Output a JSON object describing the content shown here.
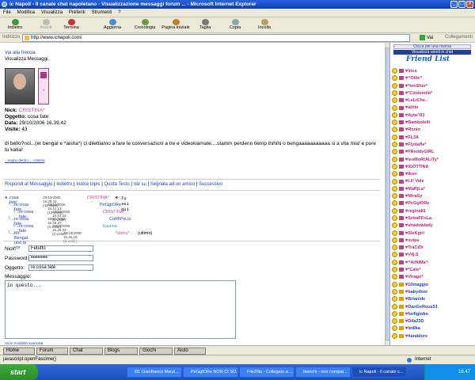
{
  "window": {
    "title": "ic Napoli - Il canale chat napoletano - Visualizzazione messaggi forum ... - Microsoft Internet Explorer"
  },
  "menu": [
    "File",
    "Modifica",
    "Visualizza",
    "Preferiti",
    "Strumenti",
    "?"
  ],
  "toolbar": {
    "back": "Indietro",
    "forward": "Avanti",
    "stop": "Termina",
    "refresh": "Aggiorna",
    "history": "Cronologia",
    "home": "Pagina iniziale",
    "cut": "Taglia",
    "copy": "Copia",
    "paste": "Incolla"
  },
  "address": {
    "label": "Indirizzo",
    "url": "http://www.icnapoli.com/",
    "go": "Vai",
    "links": "Collegamenti"
  },
  "post": {
    "goto_arrow": "Vai alla freccia",
    "heading": "Visualizza Messaggi.",
    "nick_label": "Nick:",
    "nick": "CRISTINA*",
    "subject_label": "Oggetto:",
    "subject": "cosa fate",
    "date_label": "Data:",
    "date": "29/10/2006 16.39.42",
    "visits_label": "Visite:",
    "visits": "43",
    "body": "di bello?noi...(er bengal e *aisha*) ci dilettiamo a fare le conversazioni a tre e videokiamate....stamm perdenn tiemp ihihihi o bengaaaaaaaaaaa si a vita mia! e pure tu katia!",
    "signature": "...sogno dentro.....cristina"
  },
  "actions": [
    "Rispondi al Messaggio",
    "Indietro",
    "Indice topic",
    "Quota Testo",
    "Vai su",
    "Segnala ad un amico",
    "Successivo"
  ],
  "thread": [
    {
      "title": "cosa fate",
      "date": "29/10/2006 16.39.42 (42 visite)",
      "author": "CRISTINA*",
      "note": "Tu sei qui"
    },
    {
      "title": "re:cosa fate",
      "date": "29/10/2006 16.41.13 (12 visite)",
      "author": "PeGgIORe",
      "note": ""
    },
    {
      "title": "re:cosa fate",
      "date": "29/10/2006 16.42.43 (5 visite)",
      "author": "CRISTINA*",
      "note": ""
    },
    {
      "title": "re:cosa fate",
      "date": "29/10/2006 16.45.27 (5 visite)",
      "author": "CoRN*eLio",
      "note": ""
    },
    {
      "title": "re:cosa fate",
      "date": "29/10/2006 16.45.33 (3 visite)",
      "author": "tusaina",
      "note": ""
    },
    {
      "title": "Mr. Bengal uno di voi",
      "date": "29/10/2006 16.46.19 (3 visite)",
      "author": "*aisha*",
      "note": "(ultimo)"
    }
  ],
  "form": {
    "nick_label": "Nick:",
    "nick_value": "Fetuffo",
    "password_label": "Password:",
    "password_value": "••••••••••",
    "subject_label": "Oggetto:",
    "subject_value": "re:cosa fate",
    "message_label": "Messaggio:",
    "message_value": "io questo...",
    "footer_link": "vai in modalità avanzata"
  },
  "sidebar": {
    "top_link": "Clicca per una risorsa",
    "sub_link": "Visualizza utenti in chat",
    "logo": "Friend List",
    "users": [
      "Iriss",
      "^Ollie^",
      "*IonSher*",
      "*Cinderella*",
      "LeLiChe..",
      "alriin",
      "Ayta^83",
      "Bambolelli",
      "Ronin",
      "FL3A",
      "Flydaffe*",
      "FReddyGIRL",
      "leoMoRtALiTy*",
      "IGOTTINA",
      "Ikon",
      "Lil' Vale",
      "MaRjLa*",
      "MiraSy",
      "PeGgIORe",
      "regina81",
      "SebaFFoLa.",
      "shadowlady",
      "SleKgirl",
      "vulps",
      "TraCiDi",
      "V4j.S",
      "^ArNiMa^",
      "*Cate*",
      "Vlrago*",
      "10maggio",
      "babydoor",
      "Brianide",
      "DanGeRous51",
      "forfiglobo",
      "Dila23D",
      "ledlka",
      "haraklors"
    ],
    "user_types": [
      "s",
      "s",
      "s",
      "s",
      "s",
      "s",
      "s",
      "s",
      "s",
      "s",
      "s",
      "s",
      "s",
      "s",
      "s",
      "s",
      "s",
      "s",
      "s",
      "s",
      "s",
      "s",
      "s",
      "s",
      "s",
      "s",
      "s",
      "s",
      "s",
      "f",
      "f",
      "f",
      "f",
      "f",
      "f",
      "f",
      "f"
    ]
  },
  "tabs": [
    "Home",
    "Forum",
    "Chat",
    "Blogs",
    "Giochi",
    "Aiuto"
  ],
  "status": {
    "text": "javascript:openFascime()",
    "zone": "Internet"
  },
  "taskbar": {
    "start": "start",
    "tasks": [
      "60. Gianfranco Marzi...",
      "PeGgIORe NON CI SO...",
      "FileZilla - Collegato a ...",
      "bianchi - non compat...",
      "ic Napoli - Il canale c..."
    ],
    "clock": "16.47"
  }
}
